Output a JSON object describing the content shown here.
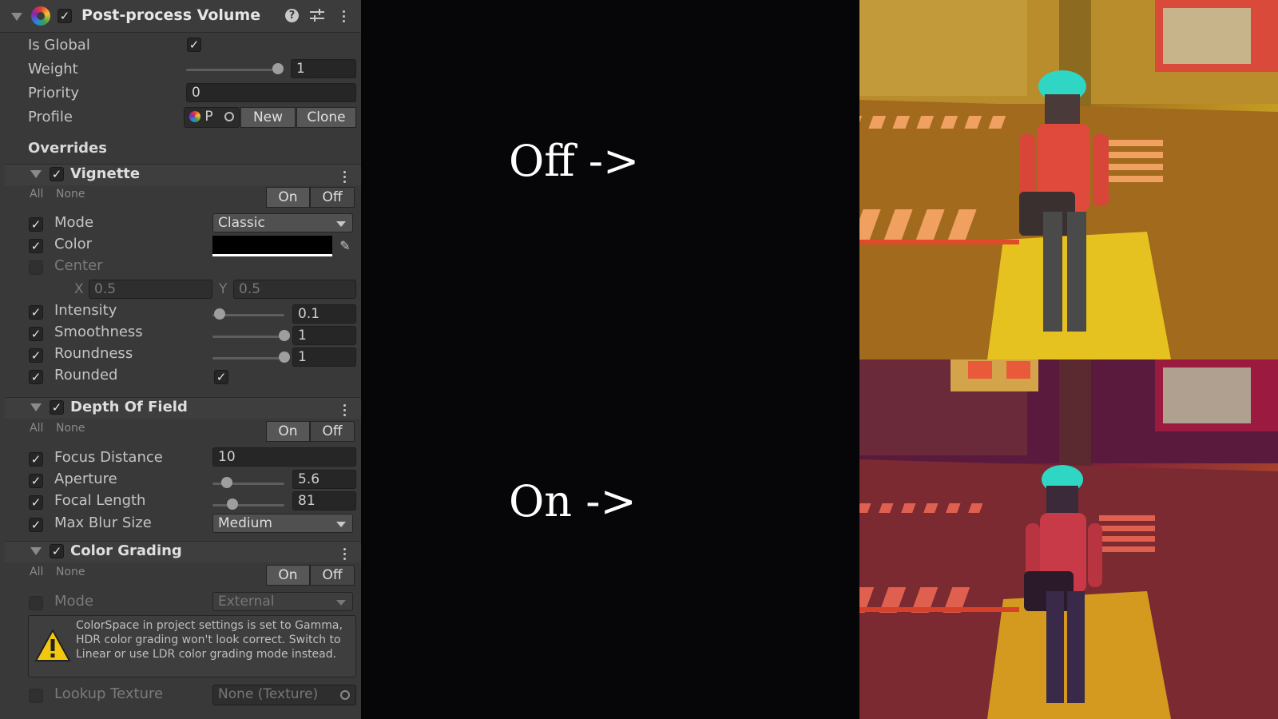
{
  "component": {
    "title": "Post-process Volume",
    "is_global_label": "Is Global",
    "weight_label": "Weight",
    "weight_value": "1",
    "weight_slider": 1.0,
    "priority_label": "Priority",
    "priority_value": "0",
    "profile_label": "Profile",
    "profile_value": "P",
    "new_label": "New",
    "clone_label": "Clone",
    "overrides_label": "Overrides"
  },
  "common": {
    "all": "All",
    "none": "None",
    "on": "On",
    "off": "Off"
  },
  "vignette": {
    "title": "Vignette",
    "mode_label": "Mode",
    "mode_value": "Classic",
    "color_label": "Color",
    "color_value": "#000000",
    "center_label": "Center",
    "x_label": "X",
    "x_value": "0.5",
    "y_label": "Y",
    "y_value": "0.5",
    "intensity_label": "Intensity",
    "intensity_value": "0.1",
    "intensity_slider": 0.1,
    "smoothness_label": "Smoothness",
    "smoothness_value": "1",
    "smoothness_slider": 1.0,
    "roundness_label": "Roundness",
    "roundness_value": "1",
    "roundness_slider": 1.0,
    "rounded_label": "Rounded"
  },
  "dof": {
    "title": "Depth Of Field",
    "focus_label": "Focus Distance",
    "focus_value": "10",
    "aperture_label": "Aperture",
    "aperture_value": "5.6",
    "aperture_slider": 0.2,
    "focal_label": "Focal Length",
    "focal_value": "81",
    "focal_slider": 0.28,
    "blur_label": "Max Blur Size",
    "blur_value": "Medium"
  },
  "grading": {
    "title": "Color Grading",
    "mode_label": "Mode",
    "mode_value": "External",
    "warning": "ColorSpace in project settings is set to Gamma, HDR color grading won't look correct. Switch to Linear or use LDR color grading mode instead.",
    "lut_label": "Lookup Texture",
    "lut_value": "None (Texture)"
  },
  "comparison": {
    "off_label": "Off ->",
    "on_label": "On ->"
  },
  "colors": {
    "panel_bg": "#393939",
    "warning_yellow": "#f2c80f",
    "hat_cyan": "#2fd6c4",
    "jacket_red": "#e04a3c"
  }
}
